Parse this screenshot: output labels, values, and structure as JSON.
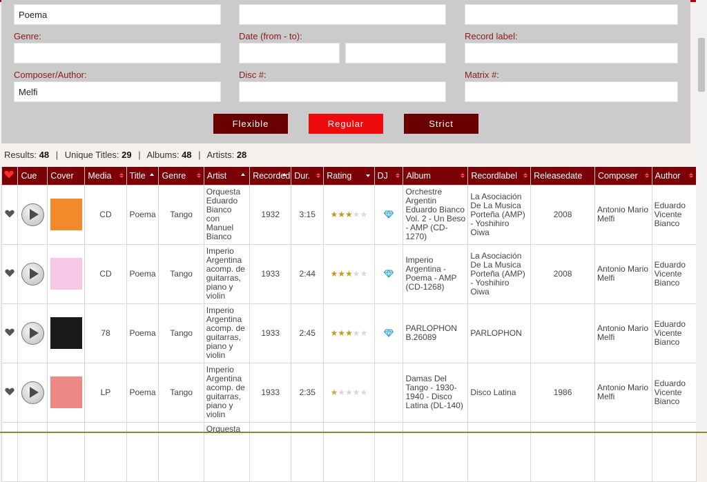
{
  "search": {
    "title_value": "Poema",
    "genre_label": "Genre:",
    "date_label": "Date (from - to):",
    "record_label_label": "Record label:",
    "composer_label": "Composer/Author:",
    "composer_value": "Melfi",
    "disc_label": "Disc #:",
    "matrix_label": "Matrix #:"
  },
  "buttons": {
    "flexible": "Flexible",
    "regular": "Regular",
    "strict": "Strict"
  },
  "summary": {
    "results_label": "Results:",
    "results": "48",
    "unique_label": "Unique Titles:",
    "unique": "29",
    "albums_label": "Albums:",
    "albums": "48",
    "artists_label": "Artists:",
    "artists": "28"
  },
  "columns": [
    "Cue",
    "Cover",
    "Media",
    "Title",
    "Genre",
    "Artist",
    "Recorded",
    "Dur.",
    "Rating",
    "DJ",
    "Album",
    "Recordlabel",
    "Releasedate",
    "Composer",
    "Author"
  ],
  "rows": [
    {
      "media": "CD",
      "title": "Poema",
      "genre": "Tango",
      "artist": "Orquesta Eduardo Bianco con Manuel Bianco",
      "recorded": "1932",
      "duration": "3:15",
      "rating": 3,
      "dj": true,
      "album": "Orchestre Argentin Eduardo Bianco Vol. 2 - Un Beso - AMP (CD-1270)",
      "recordlabel": "La Asociación De La Musica Porteña (AMP) - Yoshihiro Oiwa",
      "releasedate": "2008",
      "composer": "Antonio Mario Melfi",
      "author": "Eduardo Vicente Bianco",
      "cover_color": "#f28a2c"
    },
    {
      "media": "CD",
      "title": "Poema",
      "genre": "Tango",
      "artist": "Imperio Argentina acomp. de guitarras, piano y violin",
      "recorded": "1933",
      "duration": "2:44",
      "rating": 3,
      "dj": true,
      "album": "Imperio Argentina - Poema - AMP (CD-1268)",
      "recordlabel": "La Asociación De La Musica Porteña (AMP) - Yoshihiro Oiwa",
      "releasedate": "2008",
      "composer": "Antonio Mario Melfi",
      "author": "Eduardo Vicente Bianco",
      "cover_color": "#f7c8e6"
    },
    {
      "media": "78",
      "title": "Poema",
      "genre": "Tango",
      "artist": "Imperio Argentina acomp. de guitarras, piano y violin",
      "recorded": "1933",
      "duration": "2:45",
      "rating": 3,
      "dj": true,
      "album": "PARLOPHON B.26089",
      "recordlabel": "PARLOPHON",
      "releasedate": "",
      "composer": "Antonio Mario Melfi",
      "author": "Eduardo Vicente Bianco",
      "cover_color": "#1a1a1a"
    },
    {
      "media": "LP",
      "title": "Poema",
      "genre": "Tango",
      "artist": "Imperio Argentina acomp. de guitarras, piano y violin",
      "recorded": "1933",
      "duration": "2:35",
      "rating": 0.5,
      "dj": false,
      "album": "Damas Del Tango - 1930-1940 - Disco Latina (DL-140)",
      "recordlabel": "Disco Latina",
      "releasedate": "1986",
      "composer": "Antonio Mario Melfi",
      "author": "Eduardo Vicente Bianco",
      "cover_color": "#ee8a86"
    }
  ],
  "partial_row": {
    "artist": "Orquesta"
  }
}
